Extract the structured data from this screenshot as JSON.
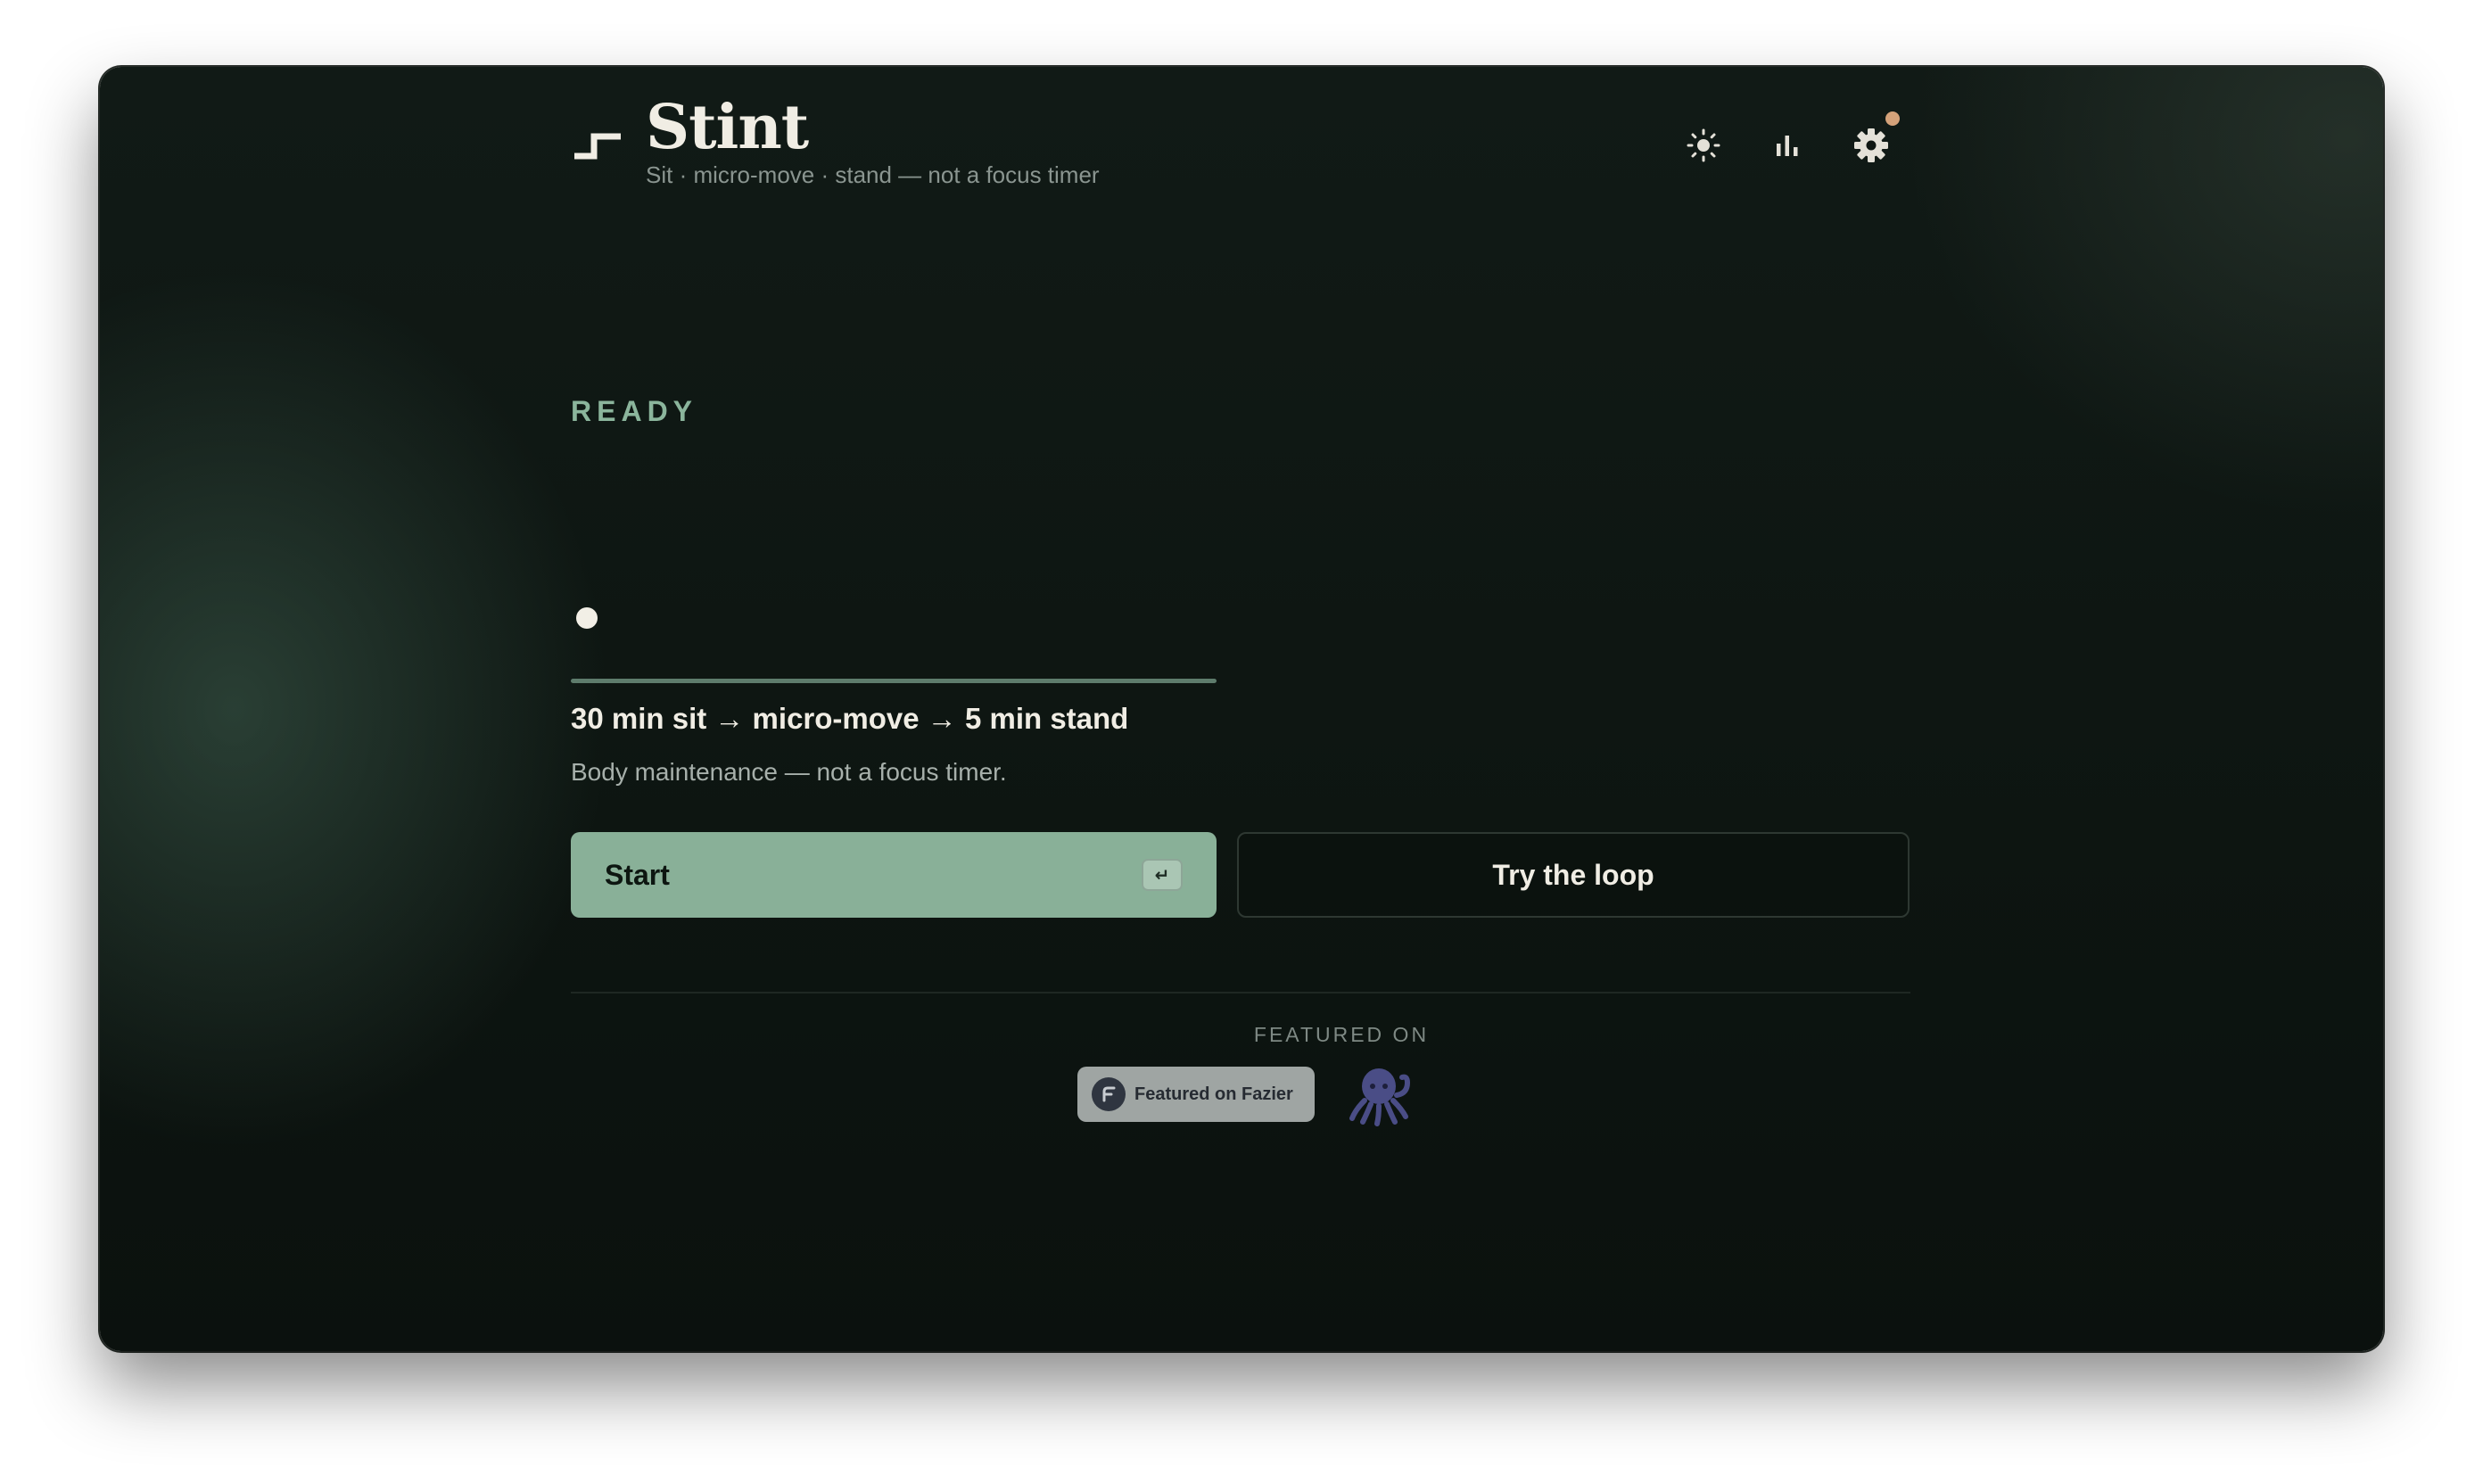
{
  "app": {
    "title": "Stint",
    "subtitle": "Sit · micro-move · stand — not a focus timer"
  },
  "header": {
    "icons": [
      "sun-icon",
      "bar-chart-icon",
      "gear-icon"
    ],
    "settings_has_notification": true
  },
  "status": {
    "label": "READY"
  },
  "progress": {
    "value": 0
  },
  "loop": {
    "summary": "30 min sit → micro-move → 5 min stand",
    "description": "Body maintenance — not a focus timer."
  },
  "actions": {
    "start_label": "Start",
    "start_shortcut": "↵",
    "try_label": "Try the loop"
  },
  "footer": {
    "featured_label": "FEATURED ON",
    "fazier_text": "Featured on Fazier",
    "octopus_icon": "octopus-icon"
  },
  "colors": {
    "accent": "#89b098",
    "status": "#8bb59c",
    "notification": "#d4a27a",
    "background": "#0d1511",
    "text": "#f0ede4"
  }
}
